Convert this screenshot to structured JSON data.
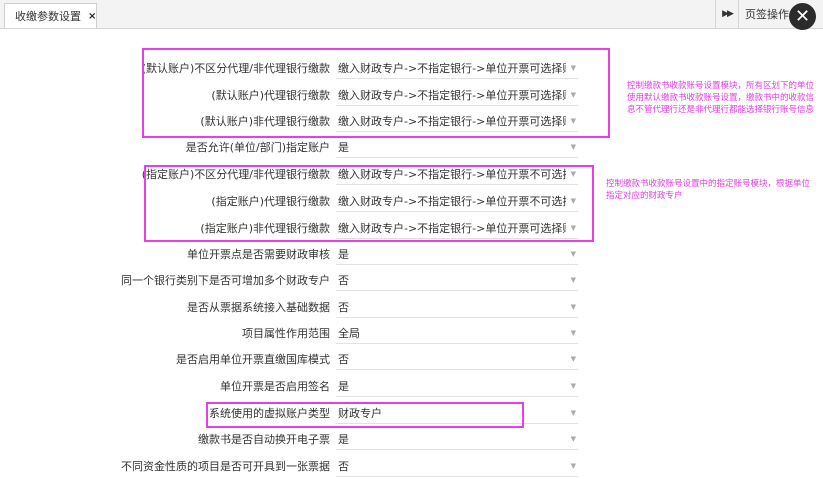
{
  "tabs": [
    {
      "label": "收缴参数设置",
      "close": "×"
    }
  ],
  "toolbar": {
    "forward_icon": "▶▶",
    "ops_label": "页签操作",
    "close_icon": "✕"
  },
  "rows": [
    {
      "label": "(默认账户)不区分代理/非代理银行缴款",
      "value": "缴入财政专户->不指定银行->单位开票可选择账户"
    },
    {
      "label": "(默认账户)代理银行缴款",
      "value": "缴入财政专户->不指定银行->单位开票可选择账户"
    },
    {
      "label": "(默认账户)非代理银行缴款",
      "value": "缴入财政专户->不指定银行->单位开票可选择账户"
    },
    {
      "label": "是否允许(单位/部门)指定账户",
      "value": "是"
    },
    {
      "label": "(指定账户)不区分代理/非代理银行缴款",
      "value": "缴入财政专户->不指定银行->单位开票不可选择账户"
    },
    {
      "label": "(指定账户)代理银行缴款",
      "value": "缴入财政专户->不指定银行->单位开票不可选择账户"
    },
    {
      "label": "(指定账户)非代理银行缴款",
      "value": "缴入财政专户->不指定银行->单位开票可选择账户"
    },
    {
      "label": "单位开票点是否需要财政审核",
      "value": "是"
    },
    {
      "label": "同一个银行类别下是否可增加多个财政专户",
      "value": "否"
    },
    {
      "label": "是否从票据系统接入基础数据",
      "value": "否"
    },
    {
      "label": "项目属性作用范围",
      "value": "全局"
    },
    {
      "label": "是否启用单位开票直缴国库模式",
      "value": "否"
    },
    {
      "label": "单位开票是否启用签名",
      "value": "是"
    },
    {
      "label": "系统使用的虚拟账户类型",
      "value": "财政专户"
    },
    {
      "label": "缴款书是否自动换开电子票",
      "value": "是"
    },
    {
      "label": "不同资金性质的项目是否可开具到一张票据",
      "value": "否"
    }
  ],
  "dropdown_icon": "▼",
  "annotations": {
    "default_accounts": "控制缴款书收款账号设置模块，所有区划下的单位使用默认缴款书收款账号设置，缴款书中的收款信息不管代理行还是非代理行都能选择银行账号信息",
    "specified_accounts": "控制缴款书收款账号设置中的指定账号模块，根据单位指定对应的财政专户"
  },
  "colors": {
    "highlight": "#e83ee8",
    "note_text": "#e33ee3"
  }
}
